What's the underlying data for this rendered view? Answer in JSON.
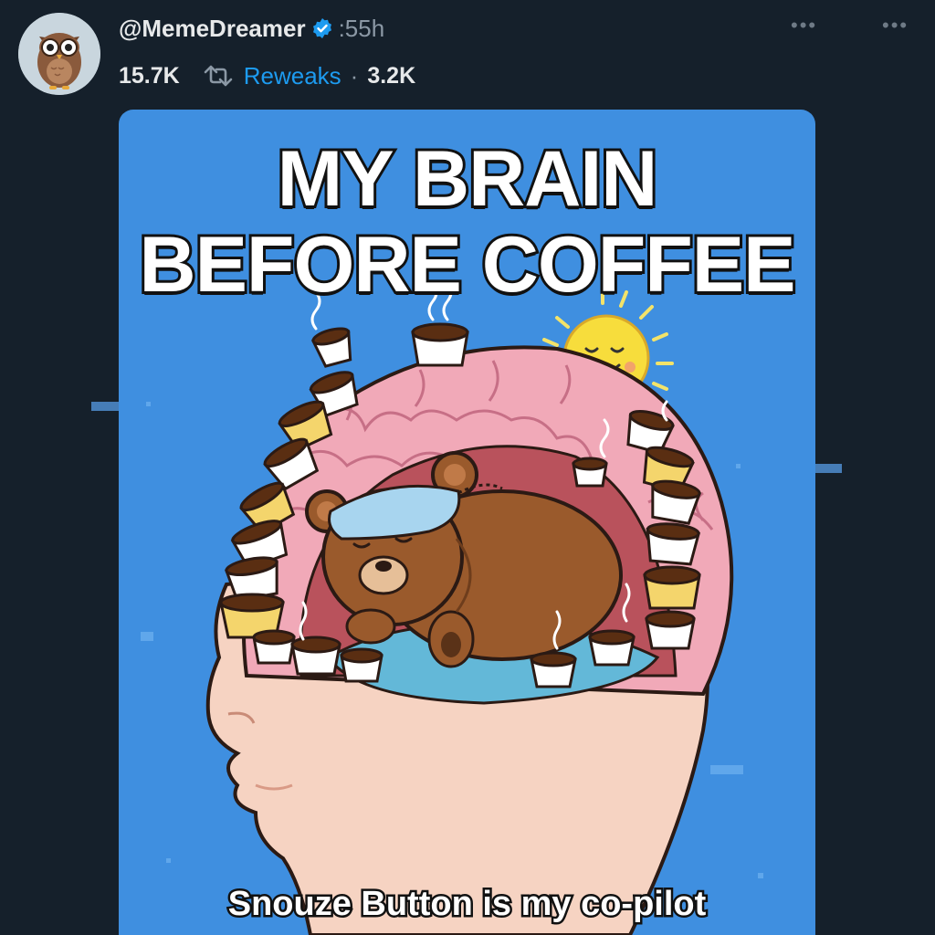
{
  "post": {
    "handle": "@MemeDreamer",
    "verified_icon": "verified-badge-icon",
    "timestamp": ":55h",
    "likes_count": "15.7K",
    "reweaks_label": "Reweaks",
    "separator": "·",
    "reweak_count": "3.2K",
    "more_icon": "more-dots-icon",
    "more_label": "•••"
  },
  "meme": {
    "title_line_1": "MY BRAIN",
    "title_line_2": "BEFORE COFFEE",
    "caption": "Snouze Button is my co-pilot"
  },
  "colors": {
    "background": "#15202b",
    "accent": "#1d9bf0",
    "meme_background": "#3f8fe0"
  }
}
